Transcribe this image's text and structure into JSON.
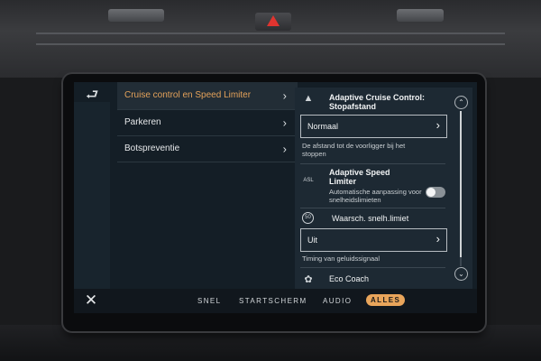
{
  "menu": {
    "back_icon": "back-arrow-icon",
    "items": [
      {
        "label": "Cruise control en Speed Limiter",
        "active": true
      },
      {
        "label": "Parkeren",
        "active": false
      },
      {
        "label": "Botspreventie",
        "active": false
      }
    ]
  },
  "panel": {
    "acc": {
      "title": "Adaptive Cruise Control: Stopafstand",
      "icon": "adaptive-cruise-icon",
      "value": "Normaal",
      "description": "De afstand tot de voorligger bij het stoppen"
    },
    "asl": {
      "title": "Adaptive Speed Limiter",
      "icon": "asl-icon",
      "icon_text": "ASL",
      "description": "Automatische aanpassing voor snelheidslimieten",
      "enabled": false
    },
    "speed_warning": {
      "title": "Waarsch. snelh.limiet",
      "icon": "speed-limit-50-icon",
      "icon_text": "50"
    },
    "sound_timing": {
      "value": "Uit",
      "description": "Timing van geluidssignaal"
    },
    "eco_coach": {
      "title": "Eco Coach",
      "icon": "eco-coach-icon"
    }
  },
  "bottom_bar": {
    "close_icon": "close-icon",
    "tabs": [
      {
        "label": "SNEL",
        "active": false
      },
      {
        "label": "STARTSCHERM",
        "active": false
      },
      {
        "label": "AUDIO",
        "active": false
      },
      {
        "label": "ALLES",
        "active": true
      }
    ]
  },
  "colors": {
    "accent": "#e9a55b",
    "screen_bg": "#141e26",
    "panel_bg": "#1d2933"
  }
}
